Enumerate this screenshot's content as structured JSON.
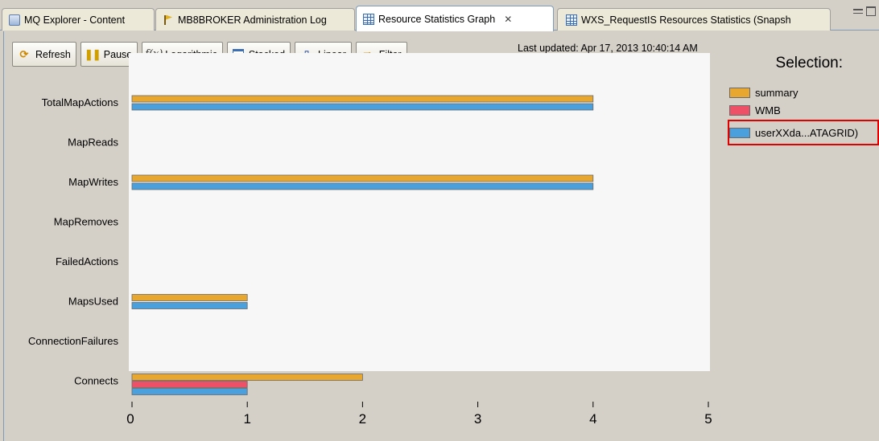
{
  "tabs": [
    {
      "label": "MQ Explorer - Content",
      "icon": "mq-explorer-icon"
    },
    {
      "label": "MB8BROKER Administration Log",
      "icon": "flag-icon"
    },
    {
      "label": "Resource Statistics Graph",
      "icon": "table-icon",
      "active": true
    },
    {
      "label": "WXS_RequestIS Resources Statistics (Snapsh",
      "icon": "table-icon"
    }
  ],
  "toolbar": {
    "refresh": "Refresh",
    "pause": "Pause",
    "logarithmic": "Logarithmic",
    "stacked": "Stacked",
    "linear": "Linear",
    "filter": "Filter",
    "last_updated": "Last updated: Apr 17, 2013 10:40:14 AM"
  },
  "legend": {
    "title": "Selection:",
    "items": [
      {
        "label": "summary",
        "color": "#e8a830"
      },
      {
        "label": "WMB",
        "color": "#ee5068"
      },
      {
        "label": "userXXda...ATAGRID)",
        "color": "#4aa0dc",
        "selected": true
      }
    ]
  },
  "chart_data": {
    "type": "bar",
    "orientation": "horizontal",
    "categories": [
      "TotalMapActions",
      "MapReads",
      "MapWrites",
      "MapRemoves",
      "FailedActions",
      "MapsUsed",
      "ConnectionFailures",
      "Connects"
    ],
    "series": [
      {
        "name": "summary",
        "color": "#e8a830",
        "values": [
          4,
          0,
          4,
          0,
          0,
          1,
          0,
          2
        ]
      },
      {
        "name": "WMB",
        "color": "#ee5068",
        "values": [
          0,
          0,
          0,
          0,
          0,
          0,
          0,
          1
        ]
      },
      {
        "name": "userXXda...ATAGRID)",
        "color": "#4aa0dc",
        "values": [
          4,
          0,
          4,
          0,
          0,
          1,
          0,
          1
        ]
      }
    ],
    "xlim": [
      0,
      5
    ],
    "xticks": [
      0,
      1,
      2,
      3,
      4,
      5
    ],
    "grid": false,
    "legend_position": "right"
  }
}
